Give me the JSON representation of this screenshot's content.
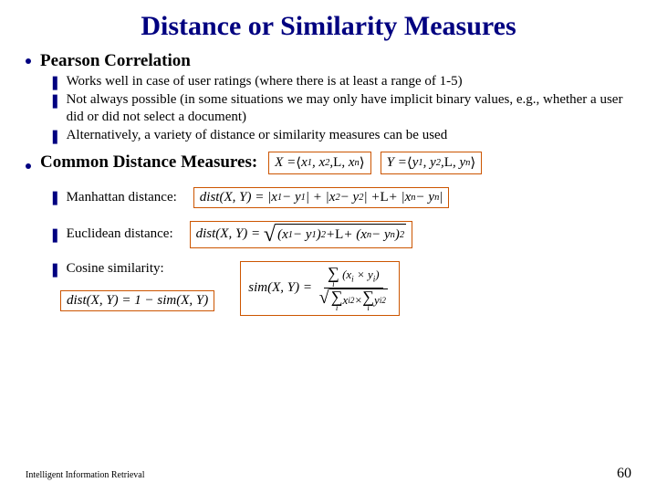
{
  "title": "Distance or Similarity Measures",
  "section1": {
    "heading": "Pearson Correlation",
    "points": [
      "Works well in case of user ratings (where there is at least a range of 1-5)",
      "Not always possible (in some situations we may only have implicit binary values, e.g., whether a user did or did not select a document)",
      "Alternatively, a variety of distance or similarity measures can be used"
    ]
  },
  "section2": {
    "heading": "Common Distance Measures:",
    "vectors": {
      "x": "X = ⟨x₁, x₂, … , xₙ⟩",
      "y": "Y = ⟨y₁, y₂, … , yₙ⟩"
    },
    "items": [
      {
        "label": "Manhattan distance:",
        "formula": "dist(X, Y) = |x₁ − y₁| + |x₂ − y₂| + … + |xₙ − yₙ|"
      },
      {
        "label": "Euclidean distance:",
        "formula": "dist(X, Y) = √((x₁ − y₁)² + … + (xₙ − yₙ)²)"
      },
      {
        "label": "Cosine similarity:",
        "dist_formula": "dist(X, Y) = 1 − sim(X, Y)",
        "sim_formula": "sim(X, Y) = Σᵢ(xᵢ × yᵢ) / √(Σᵢ xᵢ² × Σᵢ yᵢ²)"
      }
    ]
  },
  "footer": {
    "left": "Intelligent Information Retrieval",
    "right": "60"
  }
}
